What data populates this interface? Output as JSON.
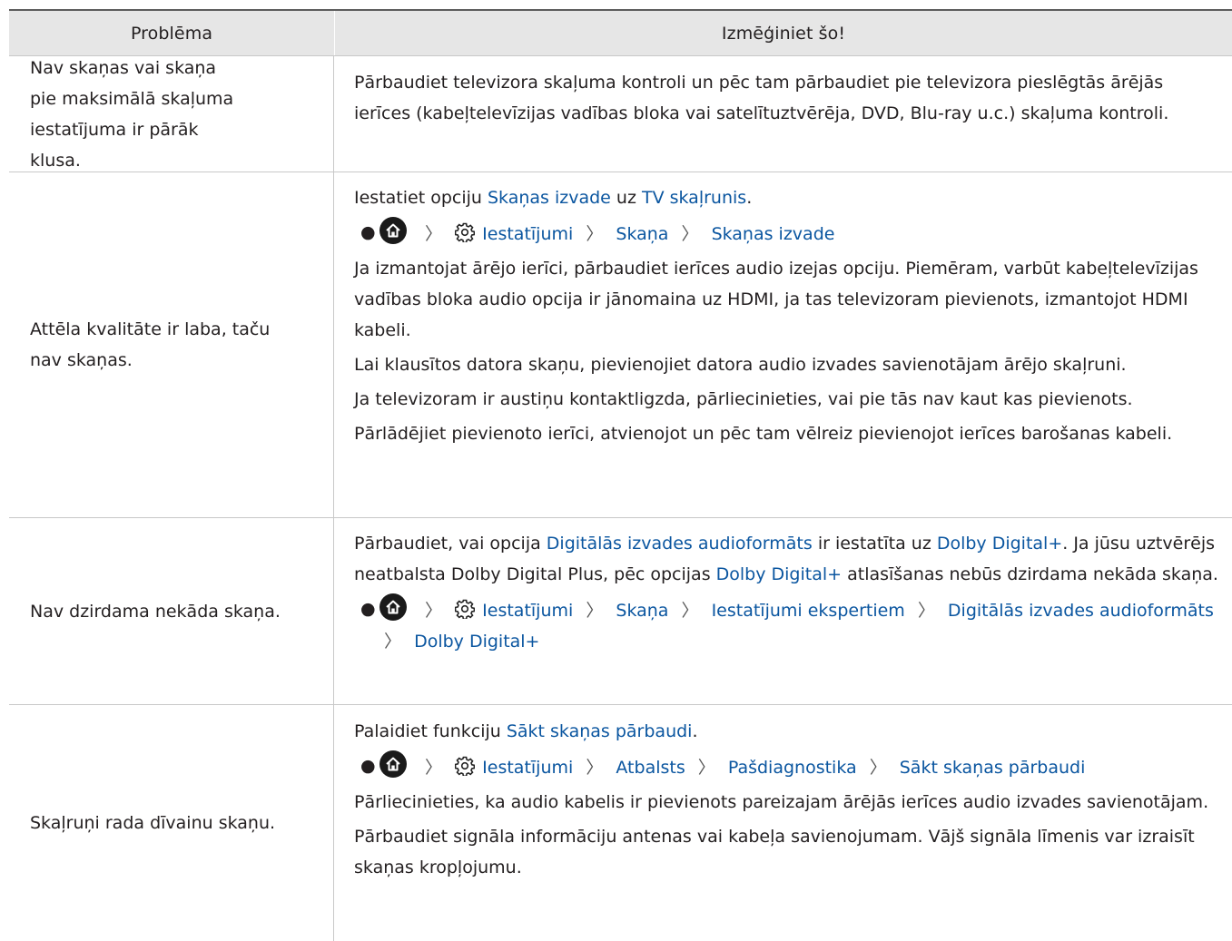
{
  "header": {
    "col1": "Problēma",
    "col2": "Izmēģiniet šo!"
  },
  "rows": [
    {
      "problem": "Nav skaņas vai skaņa pie maksimālā skaļuma iestatījuma ir pārāk klusa.",
      "p1": "Pārbaudiet televizora skaļuma kontroli un pēc tam pārbaudiet pie televizora pieslēgtās ārējās ierīces (kabeļtelevīzijas vadības bloka vai satelītuztvērēja, DVD, Blu-ray u.c.) skaļuma kontroli."
    },
    {
      "problem": "Attēla kvalitāte ir laba, taču nav skaņas.",
      "p1_a": "Iestatiet opciju ",
      "p1_link1": "Skaņas izvade",
      "p1_b": " uz ",
      "p1_link2": "TV skaļrunis",
      "p1_c": ".",
      "path": [
        "Iestatījumi",
        "Skaņa",
        "Skaņas izvade"
      ],
      "p2": "Ja izmantojat ārējo ierīci, pārbaudiet ierīces audio izejas opciju. Piemēram, varbūt kabeļtelevīzijas vadības bloka audio opcija ir jānomaina uz HDMI, ja tas televizoram pievienots, izmantojot HDMI kabeli.",
      "p3": "Lai klausītos datora skaņu, pievienojiet datora audio izvades savienotājam ārējo skaļruni.",
      "p4": "Ja televizoram ir austiņu kontaktligzda, pārliecinieties, vai pie tās nav kaut kas pievienots.",
      "p5": "Pārlādējiet pievienoto ierīci, atvienojot un pēc tam vēlreiz pievienojot ierīces barošanas kabeli."
    },
    {
      "problem": "Nav dzirdama nekāda skaņa.",
      "p1_a": "Pārbaudiet, vai opcija ",
      "p1_link1": "Digitālās izvades audioformāts",
      "p1_b": " ir iestatīta uz ",
      "p1_link2": "Dolby Digital+",
      "p1_c": ". Ja jūsu uztvērējs neatbalsta Dolby Digital Plus, pēc opcijas ",
      "p1_link3": "Dolby Digital+",
      "p1_d": " atlasīšanas nebūs dzirdama nekāda skaņa.",
      "path": [
        "Iestatījumi",
        "Skaņa",
        "Iestatījumi ekspertiem",
        "Digitālās izvades audioformāts",
        "Dolby Digital+"
      ]
    },
    {
      "problem": "Skaļruņi rada dīvainu skaņu.",
      "p1_a": "Palaidiet funkciju ",
      "p1_link1": "Sākt skaņas pārbaudi",
      "p1_b": ".",
      "path": [
        "Iestatījumi",
        "Atbalsts",
        "Pašdiagnostika",
        "Sākt skaņas pārbaudi"
      ],
      "p2": "Pārliecinieties, ka audio kabelis ir pievienots pareizajam ārējās ierīces audio izvades savienotājam.",
      "p3": "Pārbaudiet signāla informāciju antenas vai kabeļa savienojumam. Vājš signāla līmenis var izraisīt skaņas kropļojumu."
    }
  ],
  "icons": {
    "home": "home-icon",
    "settings": "gear-icon",
    "separator": "chevron-right-icon"
  }
}
